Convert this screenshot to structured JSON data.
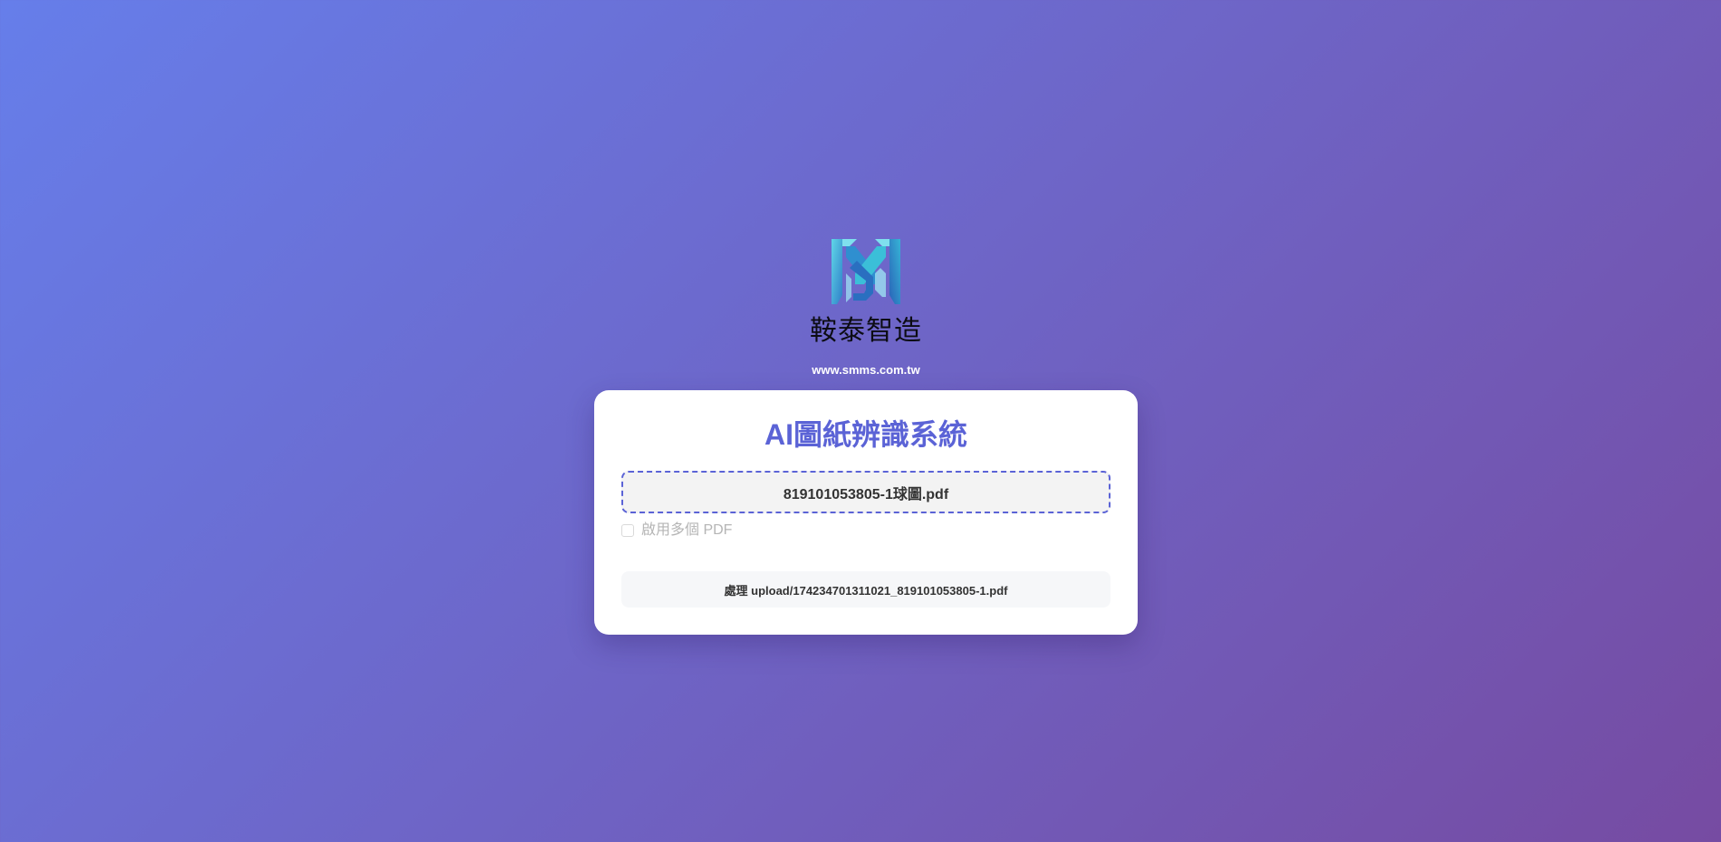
{
  "brand": {
    "company_name": "鞍泰智造",
    "website": "www.smms.com.tw",
    "logo_icon": "sm-monogram-logo-icon"
  },
  "card": {
    "title": "AI圖紙辨識系統",
    "file_name": "819101053805-1球圖.pdf",
    "multi_pdf_label": "啟用多個 PDF",
    "multi_pdf_checked": false,
    "status_text": "處理 upload/174234701311021_819101053805-1.pdf"
  },
  "colors": {
    "gradient_start": "#667eea",
    "gradient_end": "#764ba2",
    "accent": "#5b63d6",
    "logo_cyan": "#3bbfd8",
    "logo_blue": "#2f7fc8"
  }
}
